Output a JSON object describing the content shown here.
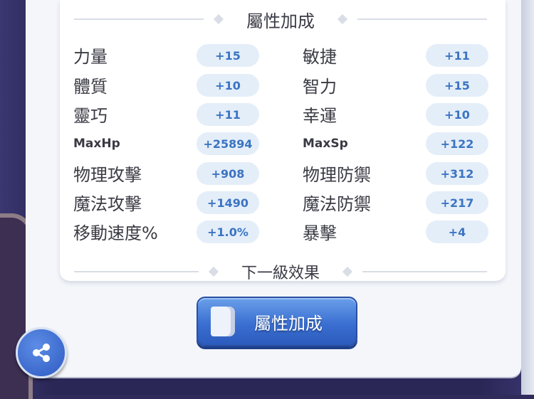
{
  "header": {
    "title": "屬性加成"
  },
  "stats_left": [
    {
      "label": "力量",
      "value": "+15"
    },
    {
      "label": "體質",
      "value": "+10"
    },
    {
      "label": "靈巧",
      "value": "+11"
    },
    {
      "label": "MaxHp",
      "value": "+25894"
    },
    {
      "label": "物理攻擊",
      "value": "+908"
    },
    {
      "label": "魔法攻擊",
      "value": "+1490"
    },
    {
      "label": "移動速度%",
      "value": "+1.0%"
    }
  ],
  "stats_right": [
    {
      "label": "敏捷",
      "value": "+11"
    },
    {
      "label": "智力",
      "value": "+15"
    },
    {
      "label": "幸運",
      "value": "+10"
    },
    {
      "label": "MaxSp",
      "value": "+122"
    },
    {
      "label": "物理防禦",
      "value": "+312"
    },
    {
      "label": "魔法防禦",
      "value": "+217"
    },
    {
      "label": "暴擊",
      "value": "+4"
    }
  ],
  "next_level": {
    "title": "下一級效果"
  },
  "bonus_button": {
    "label": "屬性加成",
    "icon": "book-icon"
  },
  "share_button": {
    "icon": "share-icon"
  },
  "colors": {
    "pill_bg": "#e4eef9",
    "pill_text": "#3b74c2",
    "button_blue": "#3b6fd1"
  }
}
